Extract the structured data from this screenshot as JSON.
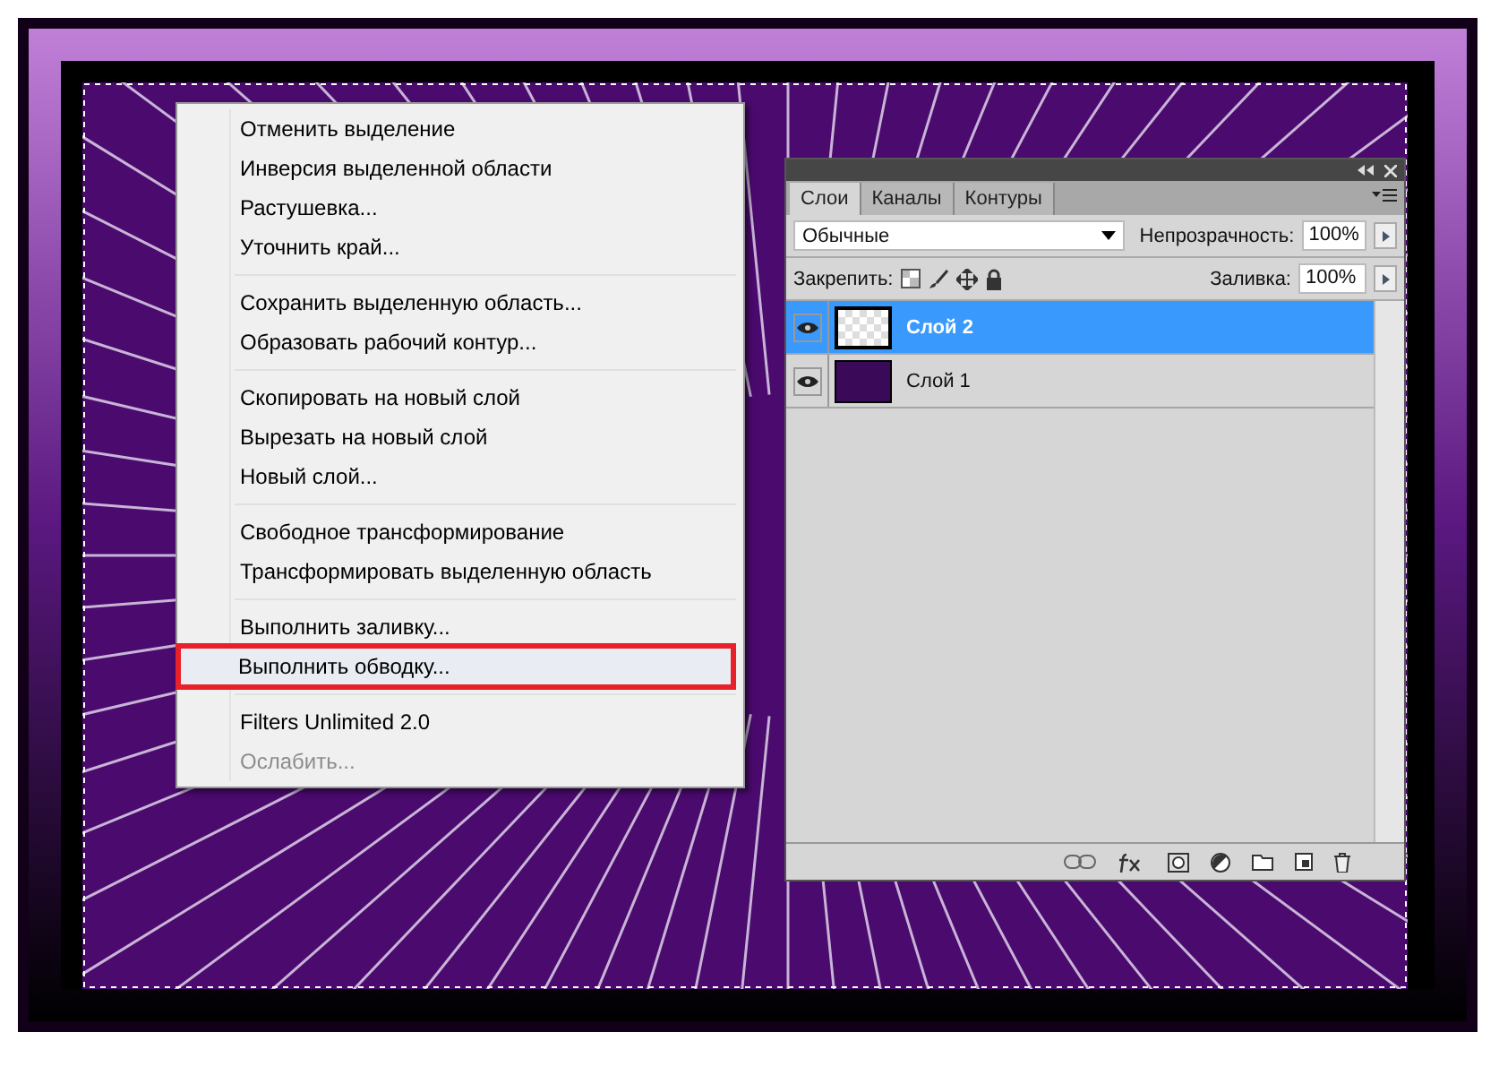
{
  "context_menu": {
    "groups": [
      {
        "items": [
          {
            "label": "Отменить выделение",
            "disabled": false,
            "highlighted": false
          },
          {
            "label": "Инверсия выделенной области",
            "disabled": false,
            "highlighted": false
          },
          {
            "label": "Растушевка...",
            "disabled": false,
            "highlighted": false
          },
          {
            "label": "Уточнить край...",
            "disabled": false,
            "highlighted": false
          }
        ]
      },
      {
        "items": [
          {
            "label": "Сохранить выделенную область...",
            "disabled": false,
            "highlighted": false
          },
          {
            "label": "Образовать рабочий контур...",
            "disabled": false,
            "highlighted": false
          }
        ]
      },
      {
        "items": [
          {
            "label": "Скопировать на новый слой",
            "disabled": false,
            "highlighted": false
          },
          {
            "label": "Вырезать на новый слой",
            "disabled": false,
            "highlighted": false
          },
          {
            "label": "Новый слой...",
            "disabled": false,
            "highlighted": false
          }
        ]
      },
      {
        "items": [
          {
            "label": "Свободное трансформирование",
            "disabled": false,
            "highlighted": false
          },
          {
            "label": "Трансформировать выделенную область",
            "disabled": false,
            "highlighted": false
          }
        ]
      },
      {
        "items": [
          {
            "label": "Выполнить заливку...",
            "disabled": false,
            "highlighted": false
          },
          {
            "label": "Выполнить обводку...",
            "disabled": false,
            "highlighted": true
          }
        ]
      },
      {
        "items": [
          {
            "label": "Filters Unlimited 2.0",
            "disabled": false,
            "highlighted": false
          },
          {
            "label": "Ослабить...",
            "disabled": true,
            "highlighted": false
          }
        ]
      }
    ]
  },
  "layers_panel": {
    "tabs": [
      {
        "label": "Слои",
        "selected": true
      },
      {
        "label": "Каналы",
        "selected": false
      },
      {
        "label": "Контуры",
        "selected": false
      }
    ],
    "blend_mode": "Обычные",
    "opacity_label": "Непрозрачность:",
    "opacity_value": "100%",
    "lock_label": "Закрепить:",
    "fill_label": "Заливка:",
    "fill_value": "100%",
    "layers": [
      {
        "name": "Слой 2",
        "selected": true,
        "visible": true,
        "kind": "transparent"
      },
      {
        "name": "Слой 1",
        "selected": false,
        "visible": true,
        "kind": "image"
      }
    ]
  }
}
